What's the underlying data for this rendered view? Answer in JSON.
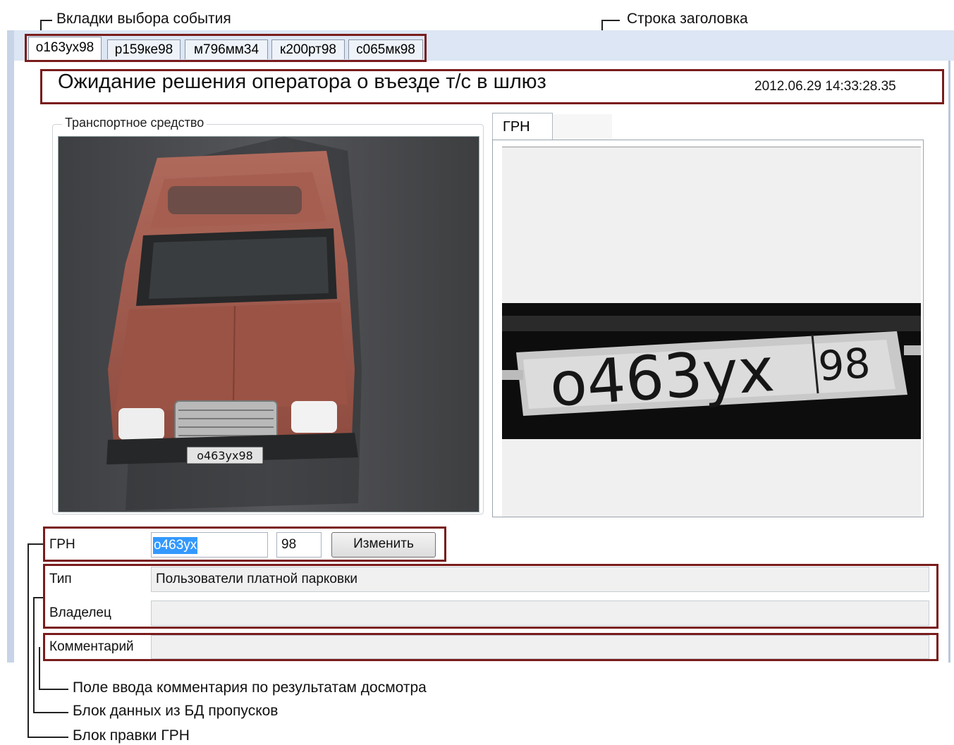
{
  "annotations": {
    "tabs_callout": "Вкладки выбора события",
    "title_callout": "Строка заголовка",
    "comment_callout": "Поле ввода комментария по результатам досмотра",
    "db_callout": "Блок данных из БД пропусков",
    "plate_edit_callout": "Блок правки ГРН"
  },
  "tabs": [
    {
      "label": "о163ух98",
      "active": true
    },
    {
      "label": "р159ке98",
      "active": false
    },
    {
      "label": "м796мм34",
      "active": false
    },
    {
      "label": "к200рт98",
      "active": false
    },
    {
      "label": "с065мк98",
      "active": false
    }
  ],
  "header": {
    "title": "Ожидание решения оператора о въезде т/с в шлюз",
    "timestamp": "2012.06.29 14:33:28.35"
  },
  "vehicle_group": {
    "legend": "Транспортное средство"
  },
  "plate_panel": {
    "tab_label": "ГРН"
  },
  "plate_edit": {
    "label": "ГРН",
    "number_value": "о463ух",
    "region_value": "98",
    "change_button": "Изменить"
  },
  "db_block": {
    "type_label": "Тип",
    "type_value": "Пользователи платной парковки",
    "owner_label": "Владелец",
    "owner_value": ""
  },
  "comment": {
    "label": "Комментарий",
    "value": ""
  },
  "colors": {
    "annotation_box": "#7a1c1c",
    "window_header": "#dce6f4",
    "selection": "#3399ff"
  }
}
